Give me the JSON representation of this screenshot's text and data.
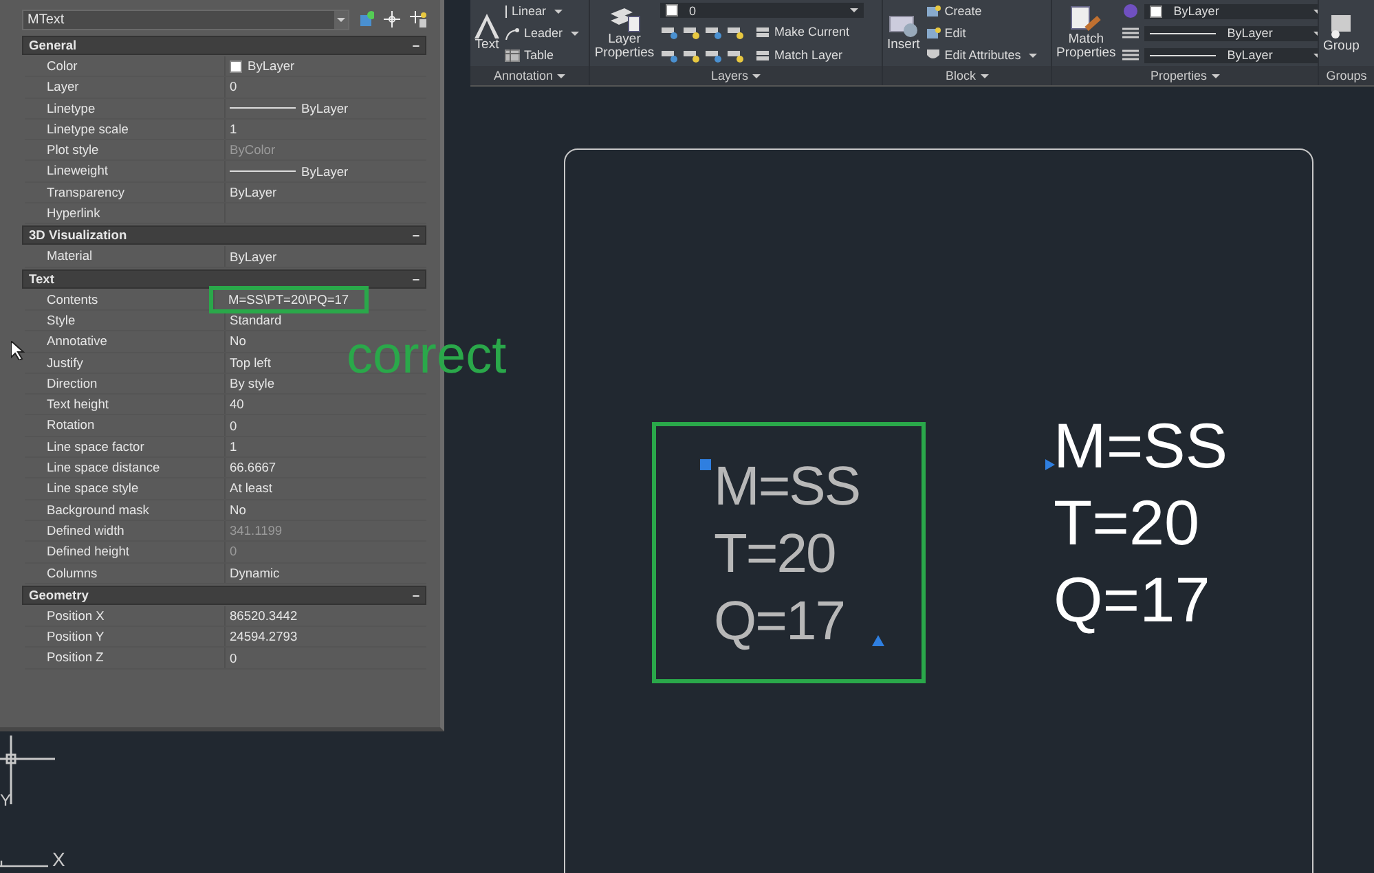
{
  "palette": {
    "object_type": "MText",
    "sections": [
      {
        "title": "General",
        "collapse": "–",
        "rows": [
          {
            "label": "Color",
            "value": "ByLayer",
            "kind": "swatch",
            "disabled": false,
            "highlighted": false
          },
          {
            "label": "Layer",
            "value": "0",
            "kind": "text",
            "disabled": false,
            "highlighted": false
          },
          {
            "label": "Linetype",
            "value": "ByLayer",
            "kind": "linetype",
            "disabled": false,
            "highlighted": false
          },
          {
            "label": "Linetype scale",
            "value": "1",
            "kind": "text",
            "disabled": false,
            "highlighted": false
          },
          {
            "label": "Plot style",
            "value": "ByColor",
            "kind": "text",
            "disabled": true,
            "highlighted": false
          },
          {
            "label": "Lineweight",
            "value": "ByLayer",
            "kind": "linetype",
            "disabled": false,
            "highlighted": false
          },
          {
            "label": "Transparency",
            "value": "ByLayer",
            "kind": "text",
            "disabled": false,
            "highlighted": false
          },
          {
            "label": "Hyperlink",
            "kind": "text",
            "highlighted": false
          }
        ]
      },
      {
        "title": "3D Visualization",
        "collapse": "–",
        "rows": [
          {
            "label": "Material",
            "value": "ByLayer",
            "kind": "text",
            "disabled": false,
            "highlighted": false
          }
        ]
      },
      {
        "title": "Text",
        "collapse": "–",
        "rows": [
          {
            "label": "Contents",
            "value": "M=SS\\PT=20\\PQ=17",
            "kind": "text",
            "disabled": false,
            "highlighted": true
          },
          {
            "label": "Style",
            "value": "Standard",
            "kind": "text",
            "disabled": false,
            "highlighted": false
          },
          {
            "label": "Annotative",
            "value": "No",
            "kind": "text",
            "disabled": false,
            "highlighted": false
          },
          {
            "label": "Justify",
            "value": "Top left",
            "kind": "text",
            "disabled": false,
            "highlighted": false
          },
          {
            "label": "Direction",
            "value": "By style",
            "kind": "text",
            "disabled": false,
            "highlighted": false
          },
          {
            "label": "Text height",
            "value": "40",
            "kind": "text",
            "disabled": false,
            "highlighted": false
          },
          {
            "label": "Rotation",
            "value": "0",
            "kind": "text",
            "disabled": false,
            "highlighted": false
          },
          {
            "label": "Line space factor",
            "value": "1",
            "kind": "text",
            "disabled": false,
            "highlighted": false
          },
          {
            "label": "Line space distance",
            "value": "66.6667",
            "kind": "text",
            "disabled": false,
            "highlighted": false
          },
          {
            "label": "Line space style",
            "value": "At least",
            "kind": "text",
            "disabled": false,
            "highlighted": false
          },
          {
            "label": "Background mask",
            "value": "No",
            "kind": "text",
            "disabled": false,
            "highlighted": false
          },
          {
            "label": "Defined width",
            "value": "341.1199",
            "kind": "text",
            "disabled": true,
            "highlighted": false
          },
          {
            "label": "Defined height",
            "value": "0",
            "kind": "text",
            "disabled": true,
            "highlighted": false
          },
          {
            "label": "Columns",
            "value": "Dynamic",
            "kind": "text",
            "disabled": false,
            "highlighted": false
          }
        ]
      },
      {
        "title": "Geometry",
        "collapse": "–",
        "rows": [
          {
            "label": "Position X",
            "value": "86520.3442",
            "kind": "text",
            "disabled": false,
            "highlighted": false
          },
          {
            "label": "Position Y",
            "value": "24594.2793",
            "kind": "text",
            "disabled": false,
            "highlighted": false
          },
          {
            "label": "Position Z",
            "value": "0",
            "kind": "text",
            "disabled": false,
            "highlighted": false
          }
        ]
      }
    ]
  },
  "ribbon": {
    "panels": [
      {
        "title": "Annotation",
        "big": {
          "label": "Text",
          "kind": "text"
        },
        "items": [
          {
            "label": "Linear",
            "kind": "dim",
            "caret": true
          },
          {
            "label": "Leader",
            "kind": "leader",
            "caret": true
          },
          {
            "label": "Table",
            "kind": "table",
            "caret": false
          }
        ]
      },
      {
        "title": "Layers",
        "big": {
          "label": "Layer Properties",
          "kind": "layers"
        },
        "dropdown": "0",
        "items": [
          {
            "label": "Make Current",
            "kind": "layer",
            "caret": false
          },
          {
            "label": "Match Layer",
            "kind": "layer",
            "caret": false
          }
        ]
      },
      {
        "title": "Block",
        "big": {
          "label": "Insert",
          "kind": "insert"
        },
        "items": [
          {
            "label": "Create",
            "kind": "block",
            "caret": false
          },
          {
            "label": "Edit",
            "kind": "block",
            "caret": false
          },
          {
            "label": "Edit Attributes",
            "kind": "attr",
            "caret": true
          }
        ]
      },
      {
        "title": "Properties",
        "big": {
          "label": "Match Properties",
          "kind": "match"
        },
        "dropdowns": [
          "ByLayer",
          "ByLayer",
          "ByLayer"
        ]
      },
      {
        "title": "Groups",
        "big": {
          "label": "Group",
          "kind": "group"
        }
      }
    ]
  },
  "drawing": {
    "note": "correct",
    "selected_text": [
      "M=SS",
      "T=20",
      "Q=17"
    ],
    "plain_text": [
      "M=SS",
      "T=20",
      "Q=17"
    ],
    "ucs": {
      "x": "X",
      "y": "Y"
    }
  }
}
